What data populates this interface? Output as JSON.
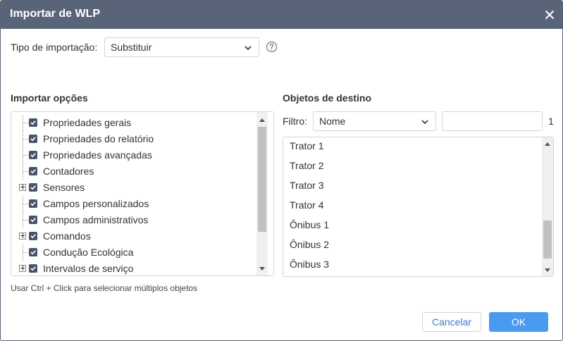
{
  "dialog": {
    "title": "Importar de WLP",
    "close_icon": "close-icon"
  },
  "import_type": {
    "label": "Tipo de importação:",
    "selected": "Substituir",
    "help_icon": "question-circle-icon"
  },
  "options": {
    "title": "Importar opções",
    "items": [
      {
        "label": "Propriedades gerais",
        "checked": true,
        "expandable": false
      },
      {
        "label": "Propriedades do relatório",
        "checked": true,
        "expandable": false
      },
      {
        "label": "Propriedades avançadas",
        "checked": true,
        "expandable": false
      },
      {
        "label": "Contadores",
        "checked": true,
        "expandable": false
      },
      {
        "label": "Sensores",
        "checked": true,
        "expandable": true
      },
      {
        "label": "Campos personalizados",
        "checked": true,
        "expandable": false
      },
      {
        "label": "Campos administrativos",
        "checked": true,
        "expandable": false
      },
      {
        "label": "Comandos",
        "checked": true,
        "expandable": true
      },
      {
        "label": "Condução Ecológica",
        "checked": true,
        "expandable": false
      },
      {
        "label": "Intervalos de serviço",
        "checked": true,
        "expandable": true
      }
    ]
  },
  "targets": {
    "title": "Objetos de destino",
    "filter_label": "Filtro:",
    "filter_selected": "Nome",
    "filter_value": "",
    "count": "1",
    "items": [
      "Trator 1",
      "Trator 2",
      "Trator 3",
      "Trator 4",
      "Ônibus 1",
      "Ônibus 2",
      "Ônibus 3"
    ]
  },
  "hint": "Usar Ctrl + Click para selecionar múltiplos objetos",
  "buttons": {
    "cancel": "Cancelar",
    "ok": "OK"
  },
  "colors": {
    "titlebar": "#5a6478",
    "accent": "#4a9af0",
    "link": "#3b82c4"
  }
}
